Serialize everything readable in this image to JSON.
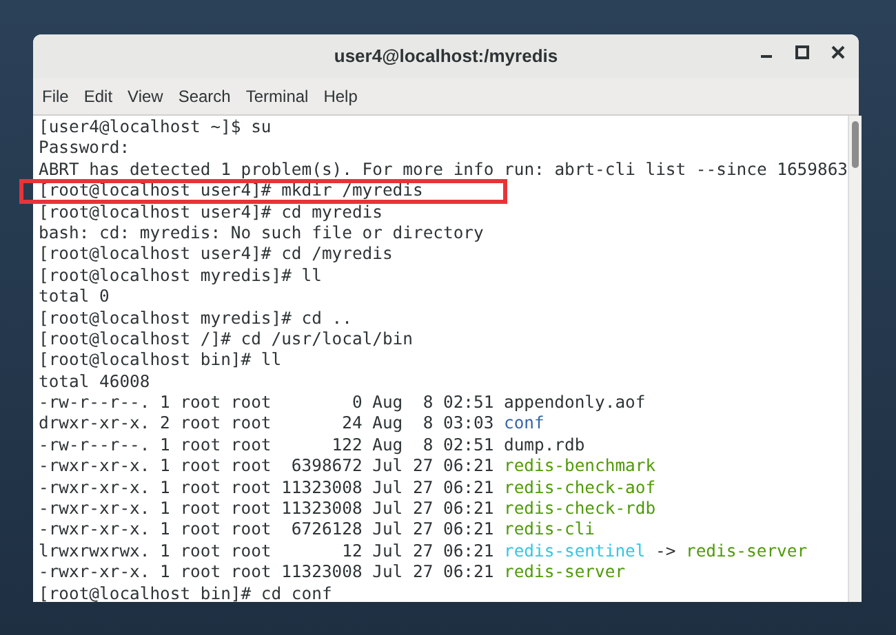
{
  "window": {
    "title": "user4@localhost:/myredis"
  },
  "menu": [
    "File",
    "Edit",
    "View",
    "Search",
    "Terminal",
    "Help"
  ],
  "terminal": {
    "lines": [
      {
        "highlighted": false,
        "segments": [
          {
            "kind": "plain",
            "text": "[user4@localhost ~]$ su"
          }
        ]
      },
      {
        "highlighted": false,
        "segments": [
          {
            "kind": "plain",
            "text": "Password:"
          }
        ]
      },
      {
        "highlighted": false,
        "segments": [
          {
            "kind": "plain",
            "text": "ABRT has detected 1 problem(s). For more info run: abrt-cli list --since 1659863"
          }
        ]
      },
      {
        "highlighted": true,
        "segments": [
          {
            "kind": "plain",
            "text": "[root@localhost user4]# mkdir /myredis"
          }
        ]
      },
      {
        "highlighted": false,
        "segments": [
          {
            "kind": "plain",
            "text": "[root@localhost user4]# cd myredis"
          }
        ]
      },
      {
        "highlighted": false,
        "segments": [
          {
            "kind": "plain",
            "text": "bash: cd: myredis: No such file or directory"
          }
        ]
      },
      {
        "highlighted": false,
        "segments": [
          {
            "kind": "plain",
            "text": "[root@localhost user4]# cd /myredis"
          }
        ]
      },
      {
        "highlighted": false,
        "segments": [
          {
            "kind": "plain",
            "text": "[root@localhost myredis]# ll"
          }
        ]
      },
      {
        "highlighted": false,
        "segments": [
          {
            "kind": "plain",
            "text": "total 0"
          }
        ]
      },
      {
        "highlighted": false,
        "segments": [
          {
            "kind": "plain",
            "text": "[root@localhost myredis]# cd .."
          }
        ]
      },
      {
        "highlighted": false,
        "segments": [
          {
            "kind": "plain",
            "text": "[root@localhost /]# cd /usr/local/bin"
          }
        ]
      },
      {
        "highlighted": false,
        "segments": [
          {
            "kind": "plain",
            "text": "[root@localhost bin]# ll"
          }
        ]
      },
      {
        "highlighted": false,
        "segments": [
          {
            "kind": "plain",
            "text": "total 46008"
          }
        ]
      },
      {
        "highlighted": false,
        "segments": [
          {
            "kind": "plain",
            "text": "-rw-r--r--. 1 root root        0 Aug  8 02:51"
          },
          {
            "kind": "plain",
            "text": "appendonly.aof"
          }
        ]
      },
      {
        "highlighted": false,
        "segments": [
          {
            "kind": "plain",
            "text": "drwxr-xr-x. 2 root root       24 Aug  8 03:03"
          },
          {
            "kind": "dir",
            "text": "conf"
          }
        ]
      },
      {
        "highlighted": false,
        "segments": [
          {
            "kind": "plain",
            "text": "-rw-r--r--. 1 root root      122 Aug  8 02:51"
          },
          {
            "kind": "plain",
            "text": "dump.rdb"
          }
        ]
      },
      {
        "highlighted": false,
        "segments": [
          {
            "kind": "plain",
            "text": "-rwxr-xr-x. 1 root root  6398672 Jul 27 06:21"
          },
          {
            "kind": "exec",
            "text": "redis-benchmark"
          }
        ]
      },
      {
        "highlighted": false,
        "segments": [
          {
            "kind": "plain",
            "text": "-rwxr-xr-x. 1 root root 11323008 Jul 27 06:21"
          },
          {
            "kind": "exec",
            "text": "redis-check-aof"
          }
        ]
      },
      {
        "highlighted": false,
        "segments": [
          {
            "kind": "plain",
            "text": "-rwxr-xr-x. 1 root root 11323008 Jul 27 06:21"
          },
          {
            "kind": "exec",
            "text": "redis-check-rdb"
          }
        ]
      },
      {
        "highlighted": false,
        "segments": [
          {
            "kind": "plain",
            "text": "-rwxr-xr-x. 1 root root  6726128 Jul 27 06:21"
          },
          {
            "kind": "exec",
            "text": "redis-cli"
          }
        ]
      },
      {
        "highlighted": false,
        "segments": [
          {
            "kind": "plain",
            "text": "lrwxrwxrwx. 1 root root       12 Jul 27 06:21"
          },
          {
            "kind": "link",
            "text": "redis-sentinel"
          },
          {
            "kind": "plain",
            "text": "->"
          },
          {
            "kind": "exec",
            "text": "redis-server"
          }
        ]
      },
      {
        "highlighted": false,
        "segments": [
          {
            "kind": "plain",
            "text": "-rwxr-xr-x. 1 root root 11323008 Jul 27 06:21"
          },
          {
            "kind": "exec",
            "text": "redis-server"
          }
        ]
      },
      {
        "highlighted": false,
        "segments": [
          {
            "kind": "plain",
            "text": "[root@localhost bin]# cd conf"
          }
        ]
      }
    ]
  }
}
